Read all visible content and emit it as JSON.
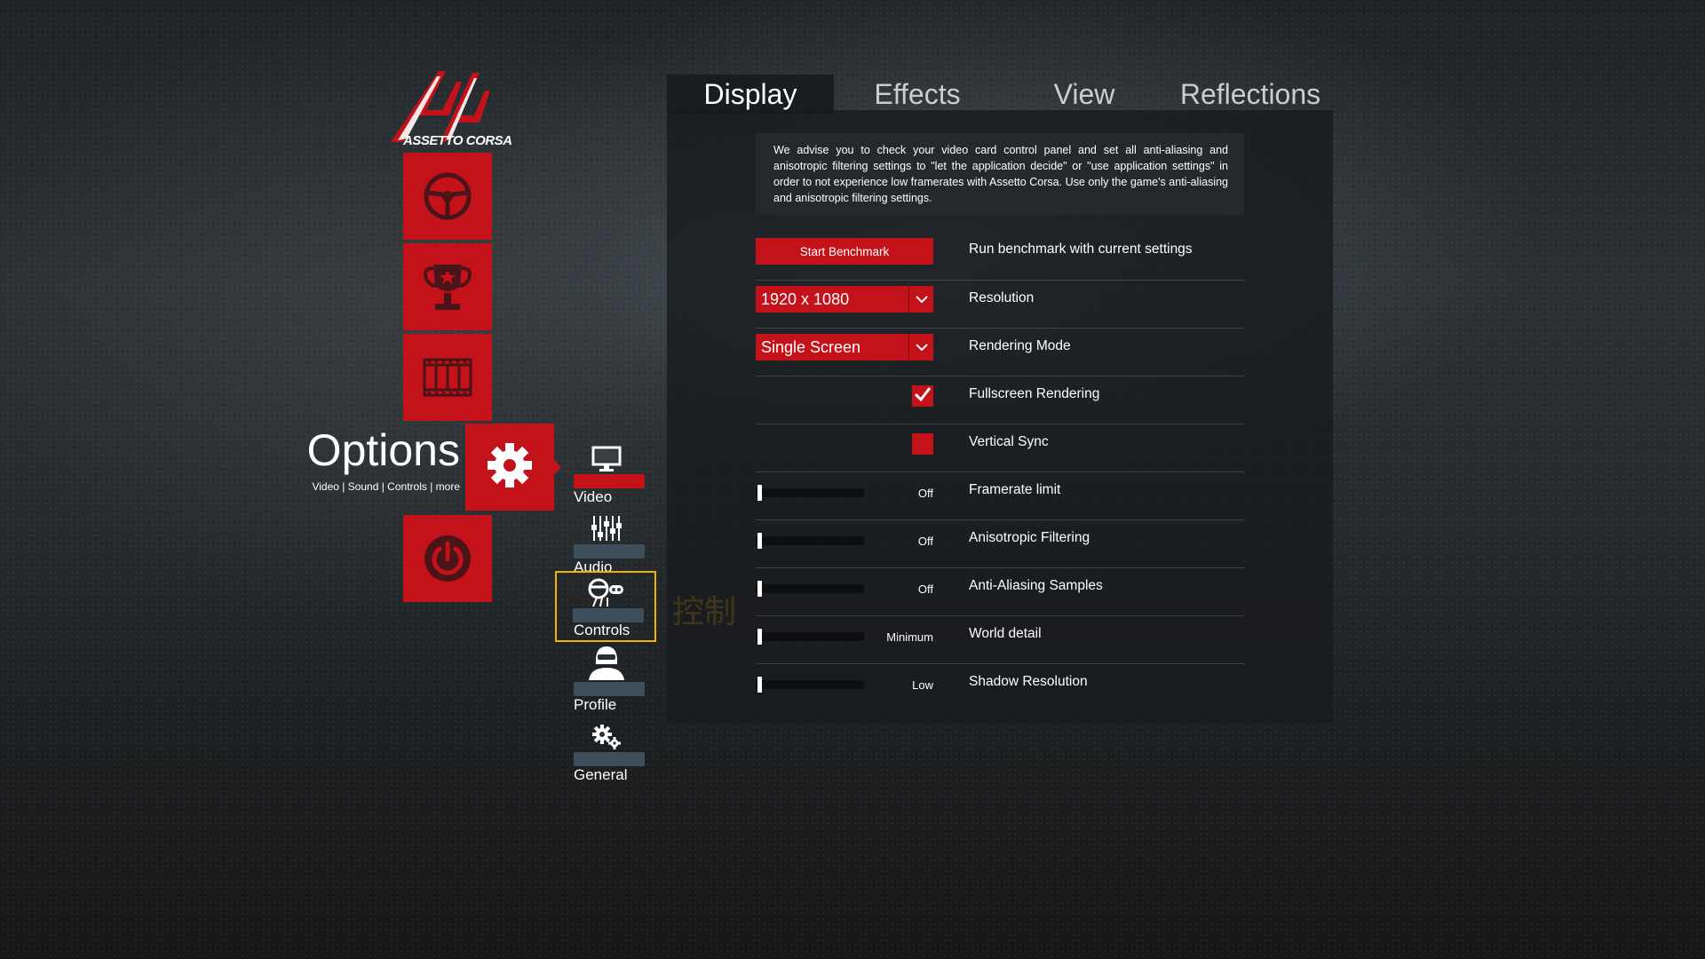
{
  "app": {
    "logo_text": "ASSETTO CORSA",
    "brand_color": "#c4121a",
    "highlight_color": "#f0b400"
  },
  "left_menu": {
    "tiles": [
      {
        "icon": "steering-wheel-icon"
      },
      {
        "icon": "trophy-icon"
      },
      {
        "icon": "film-strip-icon"
      },
      {
        "icon": "gear-icon"
      },
      {
        "icon": "power-icon"
      }
    ],
    "options_title": "Options",
    "options_subtitle": "Video | Sound | Controls | more"
  },
  "subnav": {
    "items": [
      {
        "label": "Video",
        "icon": "monitor-icon",
        "active": true
      },
      {
        "label": "Audio",
        "icon": "mixer-icon",
        "active": false
      },
      {
        "label": "Controls",
        "icon": "controls-icon",
        "active": false,
        "hovered": true
      },
      {
        "label": "Profile",
        "icon": "driver-helmet-icon",
        "active": false
      },
      {
        "label": "General",
        "icon": "gears-icon",
        "active": false
      }
    ],
    "hover_tooltip": "控制"
  },
  "tabs": [
    {
      "label": "Display",
      "active": true
    },
    {
      "label": "Effects",
      "active": false
    },
    {
      "label": "View",
      "active": false
    },
    {
      "label": "Reflections",
      "active": false
    }
  ],
  "notice": "We advise you to check your video card control panel and set all anti-aliasing and anisotropic filtering settings to \"let the application decide\" or \"use application settings\" in order to not experience low framerates with Assetto Corsa. Use only the game's anti-aliasing and anisotropic filtering settings.",
  "settings": {
    "benchmark": {
      "button": "Start Benchmark",
      "label": "Run benchmark with current settings"
    },
    "resolution": {
      "value": "1920 x 1080",
      "label": "Resolution"
    },
    "rendering_mode": {
      "value": "Single Screen",
      "label": "Rendering Mode"
    },
    "fullscreen": {
      "label": "Fullscreen Rendering",
      "checked": true
    },
    "vsync": {
      "label": "Vertical Sync",
      "checked": false
    },
    "sliders": [
      {
        "value_text": "Off",
        "label": "Framerate limit",
        "level": 0
      },
      {
        "value_text": "Off",
        "label": "Anisotropic Filtering",
        "level": 0
      },
      {
        "value_text": "Off",
        "label": "Anti-Aliasing Samples",
        "level": 0
      },
      {
        "value_text": "Minimum",
        "label": "World detail",
        "level": 0
      },
      {
        "value_text": "Low",
        "label": "Shadow Resolution",
        "level": 0
      }
    ]
  }
}
